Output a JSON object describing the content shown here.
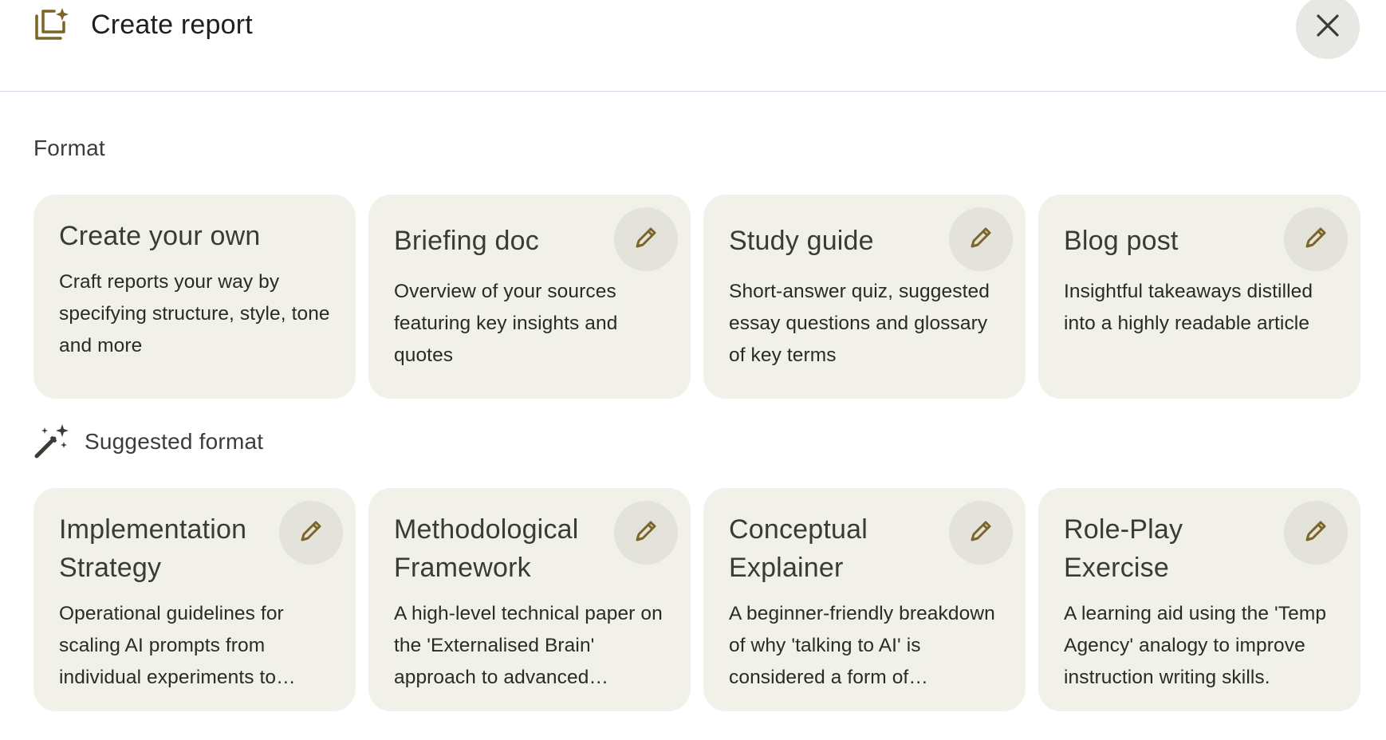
{
  "header": {
    "title": "Create report",
    "icon": "report-sparkle-icon",
    "close_icon": "close-icon"
  },
  "sections": {
    "format_label": "Format",
    "suggested_label": "Suggested format",
    "suggested_icon": "magic-wand-icon"
  },
  "format_cards": [
    {
      "title": "Create your own",
      "description": "Craft reports your way by specifying structure, style, tone and more",
      "editable": false
    },
    {
      "title": "Briefing doc",
      "description": "Overview of your sources featuring key insights and quotes",
      "editable": true
    },
    {
      "title": "Study guide",
      "description": "Short-answer quiz, suggested essay questions and glossary of key terms",
      "editable": true
    },
    {
      "title": "Blog post",
      "description": "Insightful takeaways distilled into a highly readable article",
      "editable": true
    }
  ],
  "suggested_cards": [
    {
      "title": "Implementation Strategy",
      "description": "Operational guidelines for scaling AI prompts from individual experiments to…",
      "editable": true
    },
    {
      "title": "Methodological Framework",
      "description": "A high-level technical paper on the 'Externalised Brain' approach to advanced…",
      "editable": true
    },
    {
      "title": "Conceptual Explainer",
      "description": "A beginner-friendly breakdown of why 'talking to AI' is considered a form of…",
      "editable": true
    },
    {
      "title": "Role-Play Exercise",
      "description": "A learning aid using the 'Temp Agency' analogy to improve instruction writing skills.",
      "editable": true
    }
  ],
  "colors": {
    "accent": "#7a6428",
    "card_bg": "#f1f1ea",
    "button_bg": "#e3e3dc"
  }
}
